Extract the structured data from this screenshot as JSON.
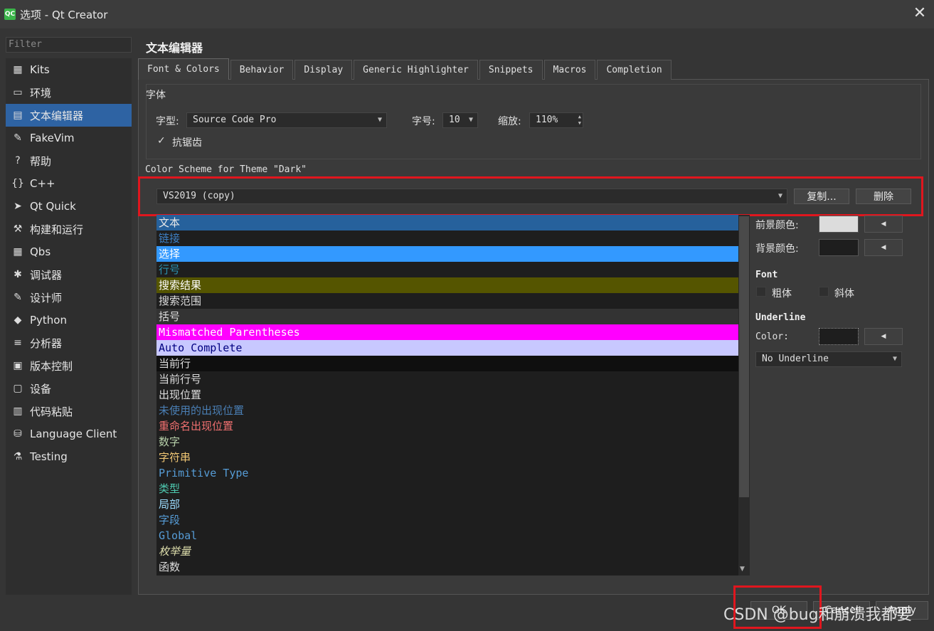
{
  "window": {
    "title": "选项 - Qt Creator",
    "app_icon_text": "QC"
  },
  "filter": {
    "placeholder": "Filter"
  },
  "sidebar": {
    "items": [
      {
        "label": "Kits",
        "icon": "kits-icon",
        "glyph": "▦"
      },
      {
        "label": "环境",
        "icon": "monitor-icon",
        "glyph": "▭"
      },
      {
        "label": "文本编辑器",
        "icon": "text-editor-icon",
        "glyph": "▤"
      },
      {
        "label": "FakeVim",
        "icon": "fakevim-icon",
        "glyph": "✎"
      },
      {
        "label": "帮助",
        "icon": "help-icon",
        "glyph": "?"
      },
      {
        "label": "C++",
        "icon": "cpp-icon",
        "glyph": "{}"
      },
      {
        "label": "Qt Quick",
        "icon": "qtquick-icon",
        "glyph": "➤"
      },
      {
        "label": "构建和运行",
        "icon": "hammer-icon",
        "glyph": "⚒"
      },
      {
        "label": "Qbs",
        "icon": "qbs-icon",
        "glyph": "▦"
      },
      {
        "label": "调试器",
        "icon": "bug-icon",
        "glyph": "✱"
      },
      {
        "label": "设计师",
        "icon": "pencil-icon",
        "glyph": "✎"
      },
      {
        "label": "Python",
        "icon": "python-icon",
        "glyph": "◆"
      },
      {
        "label": "分析器",
        "icon": "analyzer-icon",
        "glyph": "≡"
      },
      {
        "label": "版本控制",
        "icon": "version-control-icon",
        "glyph": "▣"
      },
      {
        "label": "设备",
        "icon": "device-icon",
        "glyph": "▢"
      },
      {
        "label": "代码粘贴",
        "icon": "paste-icon",
        "glyph": "▥"
      },
      {
        "label": "Language Client",
        "icon": "language-client-icon",
        "glyph": "⛁"
      },
      {
        "label": "Testing",
        "icon": "testing-icon",
        "glyph": "⚗"
      }
    ],
    "active_index": 2
  },
  "page": {
    "title": "文本编辑器"
  },
  "tabs": [
    {
      "label": "Font & Colors",
      "active": true
    },
    {
      "label": "Behavior"
    },
    {
      "label": "Display"
    },
    {
      "label": "Generic Highlighter"
    },
    {
      "label": "Snippets"
    },
    {
      "label": "Macros"
    },
    {
      "label": "Completion"
    }
  ],
  "font": {
    "group_label": "字体",
    "family_label": "字型:",
    "family_value": "Source Code Pro",
    "size_label": "字号:",
    "size_value": "10",
    "zoom_label": "缩放:",
    "zoom_value": "110%",
    "antialias_label": "抗锯齿",
    "antialias_checked": true
  },
  "scheme": {
    "label": "Color Scheme for Theme \"Dark\"",
    "value": "VS2019 (copy)",
    "copy_button": "复制...",
    "delete_button": "删除"
  },
  "color_items": [
    {
      "label": "文本",
      "fg": "#e8e8e8",
      "bg": "#26619c",
      "mono": false
    },
    {
      "label": "链接",
      "fg": "#3d7fc4",
      "bg": "#1e1e1e",
      "mono": false
    },
    {
      "label": "选择",
      "fg": "#ffffff",
      "bg": "#3399ff",
      "mono": false
    },
    {
      "label": "行号",
      "fg": "#2b91af",
      "bg": "#1e1e1e",
      "mono": false
    },
    {
      "label": "搜索结果",
      "fg": "#ffffff",
      "bg": "#555500",
      "mono": false
    },
    {
      "label": "搜索范围",
      "fg": "#dcdcdc",
      "bg": "#1e1e1e",
      "mono": false
    },
    {
      "label": "括号",
      "fg": "#dcdcdc",
      "bg": "#333333",
      "mono": false
    },
    {
      "label": "Mismatched Parentheses",
      "fg": "#ffffff",
      "bg": "#ff00ff",
      "mono": true
    },
    {
      "label": "Auto Complete",
      "fg": "#000080",
      "bg": "#c8c8ff",
      "mono": true
    },
    {
      "label": "当前行",
      "fg": "#dcdcdc",
      "bg": "#0f0f0f",
      "mono": false
    },
    {
      "label": "当前行号",
      "fg": "#dcdcdc",
      "bg": "#1e1e1e",
      "mono": false
    },
    {
      "label": "出现位置",
      "fg": "#dcdcdc",
      "bg": "#1e1e1e",
      "mono": false
    },
    {
      "label": "未使用的出现位置",
      "fg": "#4a7fb5",
      "bg": "#1e1e1e",
      "mono": false
    },
    {
      "label": "重命名出现位置",
      "fg": "#f07070",
      "bg": "#1e1e1e",
      "mono": false
    },
    {
      "label": "数字",
      "fg": "#b5cea8",
      "bg": "#1e1e1e",
      "mono": false
    },
    {
      "label": "字符串",
      "fg": "#f0c674",
      "bg": "#1e1e1e",
      "mono": false
    },
    {
      "label": "Primitive Type",
      "fg": "#569cd6",
      "bg": "#1e1e1e",
      "mono": true
    },
    {
      "label": "类型",
      "fg": "#4ec9b0",
      "bg": "#1e1e1e",
      "mono": false
    },
    {
      "label": "局部",
      "fg": "#9cdcfe",
      "bg": "#1e1e1e",
      "mono": false
    },
    {
      "label": "字段",
      "fg": "#569cd6",
      "bg": "#1e1e1e",
      "mono": false
    },
    {
      "label": "Global",
      "fg": "#569cd6",
      "bg": "#1e1e1e",
      "mono": true
    },
    {
      "label": "枚举量",
      "fg": "#dcdcaa",
      "bg": "#1e1e1e",
      "mono": false,
      "italic": true
    },
    {
      "label": "函数",
      "fg": "#dcdcdc",
      "bg": "#1e1e1e",
      "mono": false
    }
  ],
  "format": {
    "fg_label": "前景颜色:",
    "fg_color": "#dcdcdc",
    "bg_label": "背景颜色:",
    "bg_color": "#1e1e1e",
    "font_heading": "Font",
    "bold_label": "粗体",
    "italic_label": "斜体",
    "underline_heading": "Underline",
    "underline_color_label": "Color:",
    "underline_style": "No Underline",
    "arrow_glyph": "◀"
  },
  "bottom": {
    "ok_label": "OK",
    "cancel_label": "Cancel",
    "apply_label": "Apply"
  },
  "watermark": "CSDN @bug和崩溃我都要",
  "colors": {
    "highlight_red": "#e0161e",
    "active_blue": "#2e63a3"
  }
}
